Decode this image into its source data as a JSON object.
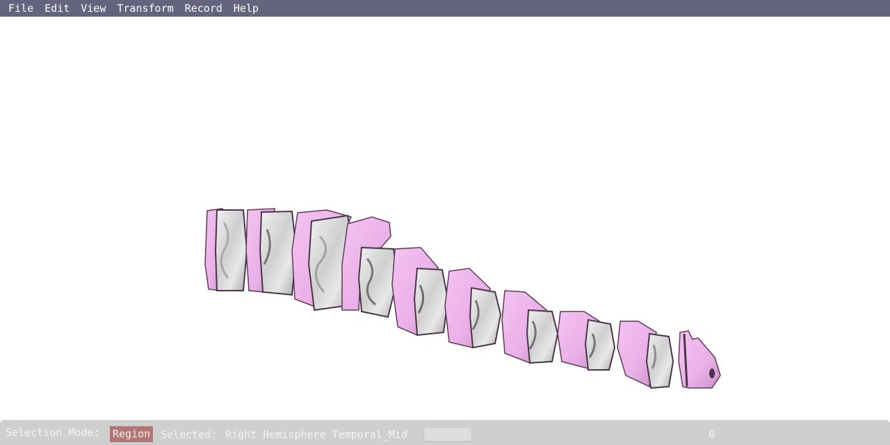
{
  "menubar": {
    "items": [
      "File",
      "Edit",
      "View",
      "Transform",
      "Record",
      "Help"
    ]
  },
  "statusbar": {
    "selection_mode_label": "Selection Mode:",
    "selection_mode_value": "Region",
    "selected_label": "Selected:",
    "selected_value": "Right Hemisphere Temporal_Mid",
    "counter": "0"
  },
  "viewport": {
    "description_icon": "brain-slab-3d-render",
    "colors": {
      "background": "#ffffff",
      "slab_face": "#eeb2ec",
      "slab_edge": "#5a3a55",
      "cut_surface": "#d6d6d6",
      "menubar": "#64647f",
      "statusbar": "#cfcfcf",
      "mode_badge": "#b57575"
    }
  }
}
